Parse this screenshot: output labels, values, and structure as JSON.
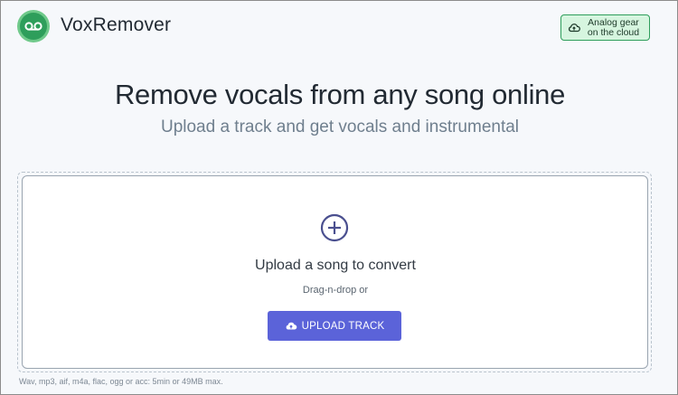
{
  "header": {
    "brand": "VoxRemover",
    "logo_icon": "cassette-icon",
    "cloud_button": {
      "icon": "cloud-upload-icon",
      "line1": "Analog gear",
      "line2": "on the cloud"
    }
  },
  "hero": {
    "title": "Remove vocals from any song online",
    "subtitle": "Upload a track and get vocals and instrumental"
  },
  "upload": {
    "icon": "plus-circle-icon",
    "heading": "Upload a song to convert",
    "drag_text": "Drag-n-drop or",
    "button_icon": "cloud-upload-icon",
    "button_label": "UPLOAD TRACK",
    "footnote": "Wav, mp3, aif, m4a, flac, ogg or acc: 5min or 49MB max."
  },
  "colors": {
    "accent": "#5b63d9",
    "brand_green": "#2e9e5b",
    "cloud_button_bg": "#d6f5df"
  }
}
